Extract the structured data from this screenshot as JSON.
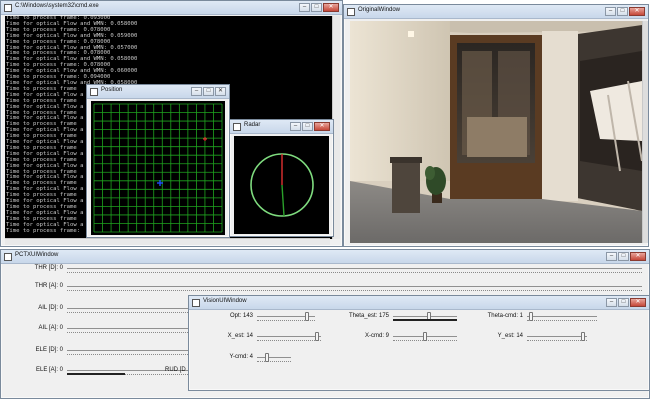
{
  "cmd_window": {
    "title": "C:\\Windows\\system32\\cmd.exe",
    "lines": [
      "Time to process frame: 0.093000",
      "Time for optical Flow and WMN: 0.058000",
      "Time to process frame: 0.078000",
      "Time for optical Flow and WMN: 0.059000",
      "Time to process frame: 0.078000",
      "Time for optical Flow and WMN: 0.057000",
      "Time to process frame: 0.078000",
      "Time for optical Flow and WMN: 0.058000",
      "Time to process frame: 0.078000",
      "Time for optical Flow and WMN: 0.060000",
      "Time to process frame: 0.094000",
      "Time for optical Flow and WMN: 0.058000",
      "Time to process frame",
      "Time for optical Flow a",
      "Time to process frame",
      "Time for optical Flow a",
      "Time to process frame",
      "Time for optical Flow a",
      "Time to process frame",
      "Time for optical Flow a",
      "Time to process frame",
      "Time for optical Flow a",
      "Time to process frame",
      "Time for optical Flow a",
      "Time to process frame",
      "Time for optical Flow a",
      "Time to process frame",
      "Time for optical Flow a",
      "Time to process frame",
      "Time for optical Flow a",
      "Time to process frame",
      "Time for optical Flow a",
      "Time to process frame",
      "Time for optical Flow a",
      "Time to process frame",
      "Time for optical Flow a",
      "Time to process frame:"
    ]
  },
  "position_window": {
    "title": "Position"
  },
  "radar_window": {
    "title": "Radar"
  },
  "original_window": {
    "title": "OriginalWindow"
  },
  "pctx_window": {
    "title": "PCTXUIWindow",
    "sliders": [
      {
        "label": "THR [D]: 0"
      },
      {
        "label": "THR [A]: 0"
      },
      {
        "label": "AIL [D]: 0"
      },
      {
        "label": "AIL [A]: 0"
      },
      {
        "label": "ELE [D]: 0"
      },
      {
        "label": "ELE [A]: 0"
      }
    ],
    "rud_label": "RUD [D"
  },
  "vision_window": {
    "title": "VisionUIWindow",
    "sliders": [
      {
        "label": "Opt: 143"
      },
      {
        "label": "Theta_est: 175"
      },
      {
        "label": "Theta-cmd: 1"
      },
      {
        "label": "X_est: 14"
      },
      {
        "label": "X-cmd: 9"
      },
      {
        "label": "Y_est: 14"
      },
      {
        "label": "Y-cmd: 4"
      }
    ]
  },
  "window_buttons": {
    "min": "–",
    "max": "□",
    "close": "✕"
  },
  "colors": {
    "grid": "#1fa31f",
    "radar_circle": "#7fdc7f",
    "radar_needle": "#e03030",
    "position_marker": "#2050ff"
  }
}
